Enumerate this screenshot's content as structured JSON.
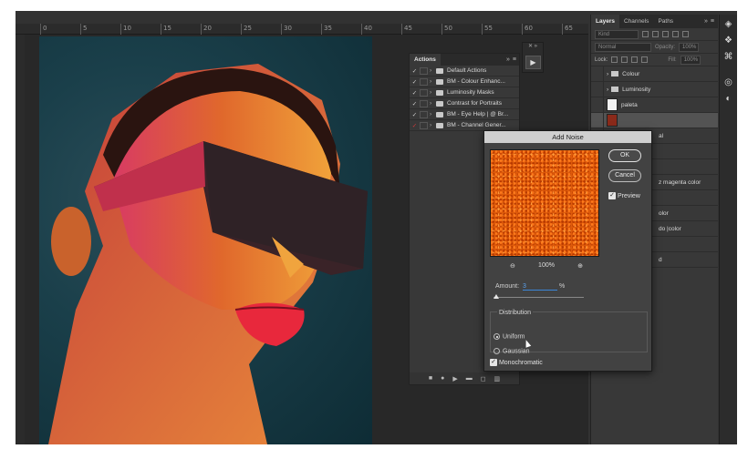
{
  "ruler": {
    "ticks": [
      "0",
      "5",
      "10",
      "15",
      "20",
      "25",
      "30",
      "35",
      "40",
      "45",
      "50",
      "55",
      "60",
      "65"
    ]
  },
  "actions": {
    "tab": "Actions",
    "items": [
      {
        "label": "Default Actions",
        "checked": true,
        "red": false
      },
      {
        "label": "BM - Colour Enhanc...",
        "checked": true,
        "red": false
      },
      {
        "label": "Luminosity Masks",
        "checked": true,
        "red": false
      },
      {
        "label": "Contrast for Portraits",
        "checked": true,
        "red": false
      },
      {
        "label": "BM - Eye Help | @ Br...",
        "checked": true,
        "red": false
      },
      {
        "label": "BM - Channel Gener...",
        "checked": true,
        "red": true
      }
    ]
  },
  "layers": {
    "tabs": [
      "Layers",
      "Channels",
      "Paths"
    ],
    "kind_placeholder": "Kind",
    "blend_mode": "Normal",
    "opacity_label": "Opacity:",
    "opacity_value": "100%",
    "lock_label": "Lock:",
    "fill_label": "Fill:",
    "fill_value": "100%",
    "rows": [
      {
        "label": "Colour"
      },
      {
        "label": "Luminosity"
      },
      {
        "label": "paleta"
      },
      {
        "label": ""
      },
      {
        "label": "al"
      },
      {
        "label": ""
      },
      {
        "label": ""
      },
      {
        "label": "z magenta color"
      },
      {
        "label": ""
      },
      {
        "label": "olor"
      },
      {
        "label": "do |color"
      },
      {
        "label": ""
      },
      {
        "label": "d"
      }
    ]
  },
  "dialog": {
    "title": "Add Noise",
    "ok": "OK",
    "cancel": "Cancel",
    "preview_label": "Preview",
    "zoom": "100%",
    "amount_label": "Amount:",
    "amount_value": "3",
    "amount_unit": "%",
    "distribution_label": "Distribution",
    "uniform_label": "Uniform",
    "gaussian_label": "Gaussian",
    "monochromatic_label": "Monochromatic"
  },
  "icons": {
    "check": "✓",
    "zoom_out": "⊖",
    "zoom_in": "⊕",
    "play": "▶",
    "menu": "≡",
    "collapse": "»"
  }
}
